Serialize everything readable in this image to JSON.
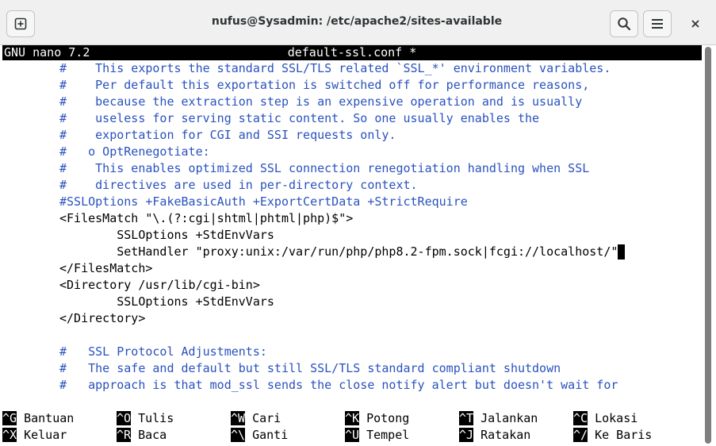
{
  "window": {
    "title": "nufus@Sysadmin: /etc/apache2/sites-available"
  },
  "icons": {
    "new_tab": "new-tab-icon",
    "search": "search-icon",
    "menu": "hamburger-menu-icon",
    "close": "close-icon"
  },
  "nano": {
    "version": "GNU nano 7.2",
    "filename": "default-ssl.conf *"
  },
  "lines": [
    "#    This exports the standard SSL/TLS related `SSL_*' environment variables.",
    "#    Per default this exportation is switched off for performance reasons,",
    "#    because the extraction step is an expensive operation and is usually",
    "#    useless for serving static content. So one usually enables the",
    "#    exportation for CGI and SSI requests only.",
    "#   o OptRenegotiate:",
    "#    This enables optimized SSL connection renegotiation handling when SSL",
    "#    directives are used in per-directory context.",
    "#SSLOptions +FakeBasicAuth +ExportCertData +StrictRequire",
    "<FilesMatch \"\\.(?:cgi|shtml|phtml|php)$\">",
    "        SSLOptions +StdEnvVars",
    "        SetHandler \"proxy:unix:/var/run/php/php8.2-fpm.sock|fcgi://localhost/\"",
    "</FilesMatch>",
    "<Directory /usr/lib/cgi-bin>",
    "        SSLOptions +StdEnvVars",
    "</Directory>",
    "",
    "#   SSL Protocol Adjustments:",
    "#   The safe and default but still SSL/TLS standard compliant shutdown",
    "#   approach is that mod_ssl sends the close notify alert but doesn't wait for"
  ],
  "shortcuts": [
    [
      {
        "key": "^G",
        "label": "Bantuan"
      },
      {
        "key": "^O",
        "label": "Tulis"
      },
      {
        "key": "^W",
        "label": "Cari"
      },
      {
        "key": "^K",
        "label": "Potong"
      },
      {
        "key": "^T",
        "label": "Jalankan"
      },
      {
        "key": "^C",
        "label": "Lokasi"
      }
    ],
    [
      {
        "key": "^X",
        "label": "Keluar"
      },
      {
        "key": "^R",
        "label": "Baca"
      },
      {
        "key": "^\\",
        "label": "Ganti"
      },
      {
        "key": "^U",
        "label": "Tempel"
      },
      {
        "key": "^J",
        "label": "Ratakan"
      },
      {
        "key": "^/",
        "label": "Ke Baris"
      }
    ]
  ],
  "colors": {
    "comment": "#2a52be",
    "text": "#000000",
    "header_bg": "#000000",
    "header_fg": "#ffffff"
  }
}
